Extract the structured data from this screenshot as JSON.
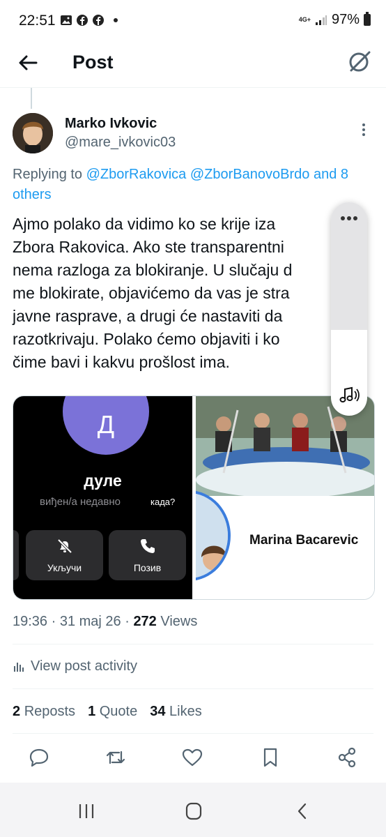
{
  "status_bar": {
    "time": "22:51",
    "network": "4G+",
    "battery": "97%"
  },
  "header": {
    "title": "Post",
    "back_icon": "arrow-left-icon",
    "grok_icon": "grok-icon"
  },
  "post": {
    "author_name": "Marko Ivkovic",
    "author_handle": "@mare_ivkovic03",
    "replying_prefix": "Replying to",
    "replying_mention_1": "@ZborRakovica",
    "replying_mention_2": "@ZborBanovoBrdo",
    "replying_suffix": "and 8 others",
    "text_lines": [
      "Ajmo polako da vidimo ko se krije iza",
      "Zbora Rakovica. Ako ste transparentni",
      "nema razloga za blokiranje. U slučaju d",
      "me blokirate, objavićemo da vas je stra",
      "javne rasprave, a drugi će nastaviti da",
      "razotkrivaju. Polako ćemo objaviti i ko",
      "čime bavi i kakvu prošlost ima."
    ],
    "media_left": {
      "initial": "Д",
      "name": "дуле",
      "seen": "виђен/а недавно",
      "when": "када?",
      "button_1": "Укључи",
      "button_2": "Позив"
    },
    "media_right": {
      "profile_name": "Marina Bacarevic"
    },
    "timestamp": "19:36 · 31 maj 26 · ",
    "views_count": "272",
    "views_label": " Views",
    "activity_label": "View post activity",
    "reposts_count": "2",
    "reposts_label": "Reposts",
    "quotes_count": "1",
    "quotes_label": "Quote",
    "likes_count": "34",
    "likes_label": "Likes"
  },
  "colors": {
    "accent": "#1d9bf0",
    "secondary_text": "#536471",
    "contact_avatar": "#7b72d8"
  }
}
